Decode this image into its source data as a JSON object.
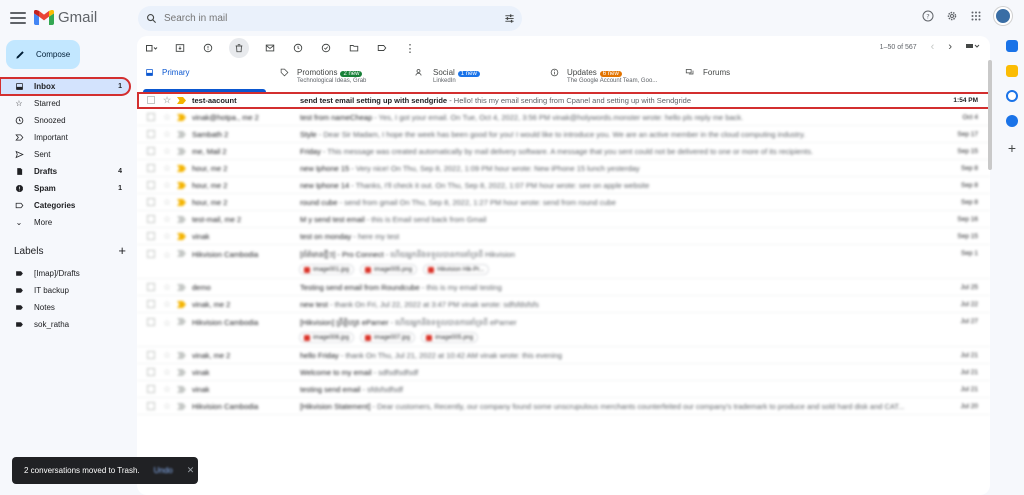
{
  "app": {
    "name": "Gmail"
  },
  "search": {
    "placeholder": "Search in mail"
  },
  "compose_label": "Compose",
  "nav": [
    {
      "label": "Inbox",
      "count": "1",
      "icon": "inbox-icon"
    },
    {
      "label": "Starred",
      "count": "",
      "icon": "star-icon"
    },
    {
      "label": "Snoozed",
      "count": "",
      "icon": "clock-icon"
    },
    {
      "label": "Important",
      "count": "",
      "icon": "important-icon"
    },
    {
      "label": "Sent",
      "count": "",
      "icon": "send-icon"
    },
    {
      "label": "Drafts",
      "count": "4",
      "icon": "draft-icon"
    },
    {
      "label": "Spam",
      "count": "1",
      "icon": "spam-icon"
    },
    {
      "label": "Categories",
      "count": "",
      "icon": "label-icon"
    },
    {
      "label": "More",
      "count": "",
      "icon": "chevron-down-icon"
    }
  ],
  "labels_title": "Labels",
  "labels": [
    "[Imap]/Drafts",
    "IT backup",
    "Notes",
    "sok_ratha"
  ],
  "pager": {
    "range": "1–50 of 567"
  },
  "tabs": [
    {
      "label": "Primary",
      "badge": "",
      "sub": ""
    },
    {
      "label": "Promotions",
      "badge": "2 new",
      "sub": "Technological Ideas, Grab"
    },
    {
      "label": "Social",
      "badge": "1 new",
      "sub": "LinkedIn"
    },
    {
      "label": "Updates",
      "badge": "6 new",
      "sub": "The Google Account Team, Goo..."
    },
    {
      "label": "Forums",
      "badge": "",
      "sub": ""
    }
  ],
  "colors": {
    "promo_badge": "#188038",
    "social_badge": "#1a73e8",
    "updates_badge": "#e37400",
    "highlight": "#d32f2f"
  },
  "emails": [
    {
      "sender": "test-aacount",
      "subject": "send test email setting up with sendgride",
      "snippet": " - Hello! this my email sending from Cpanel and setting up with Sendgride",
      "date": "1:54 PM"
    },
    {
      "sender": "vinak@hotpa., me 2",
      "subject": "test from nameCheap",
      "snippet": " - Yes, I got your email. On Tue, Oct 4, 2022, 3:56 PM vinak@holywords.monster wrote: hello pls reply me back.",
      "date": "Oct 4"
    },
    {
      "sender": "Sambath 2",
      "subject": "Style",
      "snippet": " - Dear Sir Madam, I hope the week has been good for you! I would like to introduce you. We are an active member in the cloud computing industry.",
      "date": "Sep 17"
    },
    {
      "sender": "me, Mail 2",
      "subject": "Friday",
      "snippet": " - This message was created automatically by mail delivery software. A message that you sent could not be delivered to one or more of its recipients.",
      "date": "Sep 15"
    },
    {
      "sender": "hour, me 2",
      "subject": "new Iphone 15",
      "snippet": " - Very nice! On Thu, Sep 8, 2022, 1:09 PM hour wrote: New iPhone 15 lunch yesterday",
      "date": "Sep 8"
    },
    {
      "sender": "hour, me 2",
      "subject": "new Iphone 14",
      "snippet": " - Thanks, I'll check it out. On Thu, Sep 8, 2022, 1:07 PM hour wrote: see on apple website",
      "date": "Sep 8"
    },
    {
      "sender": "hour, me 2",
      "subject": "round cube",
      "snippet": " - send from gmail On Thu, Sep 8, 2022, 1:27 PM hour wrote: send from round cube",
      "date": "Sep 8"
    },
    {
      "sender": "test-mail, me 2",
      "subject": "M y send test email",
      "snippet": " - this is Email send back from Gmail",
      "date": "Sep 16"
    },
    {
      "sender": "vinak",
      "subject": "test on monday",
      "snippet": " - here my test",
      "date": "Sep 15"
    },
    {
      "sender": "Hikvision Cambodia",
      "subject": "[ព័ត៌មានថ្មីៗ] - Pro Connect",
      "snippet": " - ហើយអ្នកនឹងទទួលបានការគាំទ្រពី Hikvision",
      "date": "Sep 1",
      "attachments": [
        "image001.jpg",
        "image005.png",
        "Hikvision Hik-Pr..."
      ]
    },
    {
      "sender": "demo",
      "subject": "Testing send email from Roundcube",
      "snippet": " - this is my email testing",
      "date": "Jul 25"
    },
    {
      "sender": "vinak, me 2",
      "subject": "new test",
      "snippet": " - thank On Fri, Jul 22, 2022 at 3:47 PM vinak wrote: sdfsfdsfsfs",
      "date": "Jul 22"
    },
    {
      "sender": "Hikvision Cambodia",
      "subject": "[Hikvision] ព្រឹត្តិបត្រ eParner",
      "snippet": " - ហើយអ្នកនឹងទទួលបានការគាំទ្រពី eParner",
      "date": "Jul 27",
      "attachments": [
        "image006.jpg",
        "image007.jpg",
        "image005.png"
      ]
    },
    {
      "sender": "vinak, me 2",
      "subject": "hello Friday",
      "snippet": " - thank On Thu, Jul 21, 2022 at 10:42 AM vinak wrote: this evening",
      "date": "Jul 21"
    },
    {
      "sender": "vinak",
      "subject": "Welcome to my email",
      "snippet": " - sdfsdfsdfsdf",
      "date": "Jul 21"
    },
    {
      "sender": "vinak",
      "subject": "testing send email",
      "snippet": " - sfdsfsdfsdf",
      "date": "Jul 21"
    },
    {
      "sender": "Hikvision Cambodia",
      "subject": "[Hikvision Statement]",
      "snippet": " - Dear customers, Recently, our company found some unscrupulous merchants counterfeited our company's trademark to produce and sold hard disk and CAT...",
      "date": "Jul 20"
    }
  ],
  "toast": {
    "message": "2 conversations moved to Trash.",
    "undo": "Undo"
  }
}
